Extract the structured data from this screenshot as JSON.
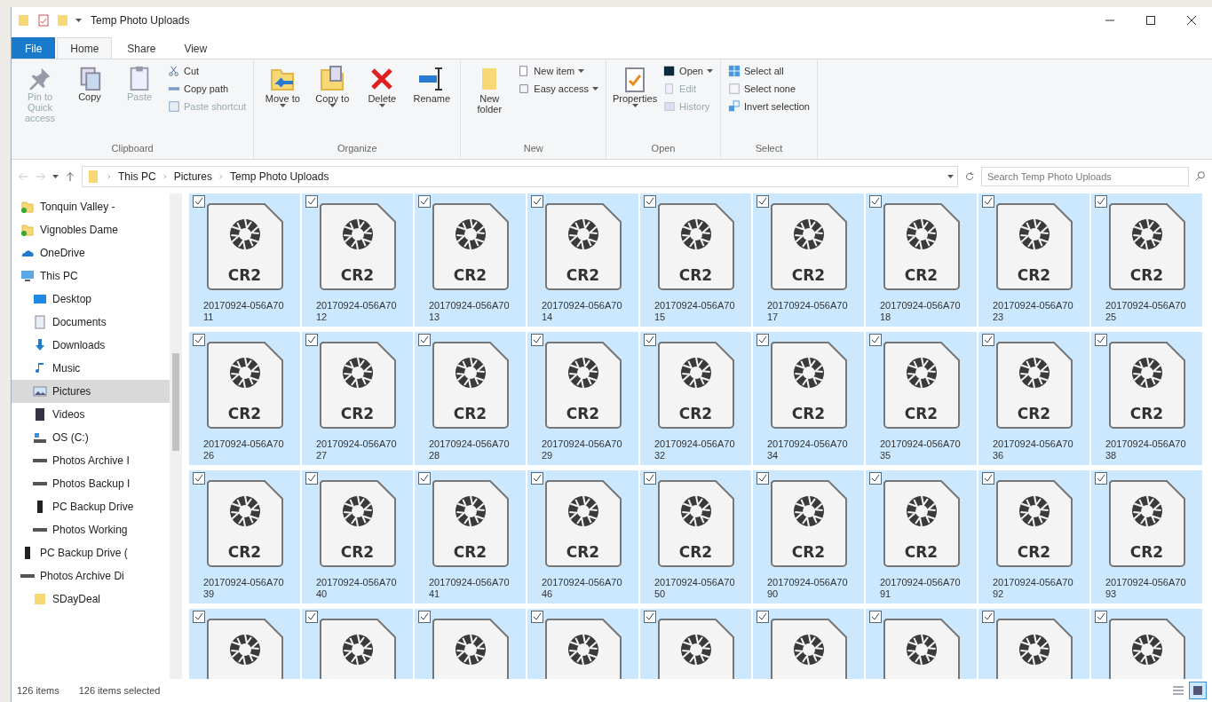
{
  "window": {
    "title": "Temp Photo Uploads"
  },
  "tabs": [
    {
      "label": "File",
      "kind": "file",
      "selected": false
    },
    {
      "label": "Home",
      "kind": "tab",
      "selected": true
    },
    {
      "label": "Share",
      "kind": "tab",
      "selected": false
    },
    {
      "label": "View",
      "kind": "tab",
      "selected": false
    }
  ],
  "ribbon": [
    {
      "label": "Clipboard",
      "buttons": [
        {
          "kind": "large",
          "label": "Pin to Quick access",
          "disabled": true,
          "dropdown": false
        },
        {
          "kind": "large",
          "label": "Copy",
          "disabled": false,
          "dropdown": false
        },
        {
          "kind": "large",
          "label": "Paste",
          "disabled": true,
          "dropdown": false
        },
        {
          "kind": "small",
          "label": "Cut",
          "disabled": false,
          "dropdown": false
        },
        {
          "kind": "small",
          "label": "Copy path",
          "disabled": false,
          "dropdown": false
        },
        {
          "kind": "small",
          "label": "Paste shortcut",
          "disabled": true,
          "dropdown": false
        }
      ]
    },
    {
      "label": "Organize",
      "buttons": [
        {
          "kind": "large",
          "label": "Move to",
          "disabled": false,
          "dropdown": true
        },
        {
          "kind": "large",
          "label": "Copy to",
          "disabled": false,
          "dropdown": true
        },
        {
          "kind": "large",
          "label": "Delete",
          "disabled": false,
          "dropdown": true
        },
        {
          "kind": "large",
          "label": "Rename",
          "disabled": false,
          "dropdown": false
        }
      ]
    },
    {
      "label": "New",
      "buttons": [
        {
          "kind": "large",
          "label": "New folder",
          "disabled": false,
          "dropdown": false
        },
        {
          "kind": "small",
          "label": "New item",
          "disabled": false,
          "dropdown": true
        },
        {
          "kind": "small",
          "label": "Easy access",
          "disabled": false,
          "dropdown": true
        }
      ]
    },
    {
      "label": "Open",
      "buttons": [
        {
          "kind": "large",
          "label": "Properties",
          "disabled": false,
          "dropdown": true
        },
        {
          "kind": "small",
          "label": "Open",
          "disabled": false,
          "dropdown": true
        },
        {
          "kind": "small",
          "label": "Edit",
          "disabled": true,
          "dropdown": false
        },
        {
          "kind": "small",
          "label": "History",
          "disabled": true,
          "dropdown": false
        }
      ]
    },
    {
      "label": "Select",
      "buttons": [
        {
          "kind": "small",
          "label": "Select all",
          "disabled": false,
          "dropdown": false
        },
        {
          "kind": "small",
          "label": "Select none",
          "disabled": false,
          "dropdown": false
        },
        {
          "kind": "small",
          "label": "Invert selection",
          "disabled": false,
          "dropdown": false
        }
      ]
    }
  ],
  "address": {
    "crumbs": [
      "This PC",
      "Pictures",
      "Temp Photo Uploads"
    ],
    "search": {
      "placeholder": "Search Temp Photo Uploads"
    }
  },
  "sidebar": {
    "items": [
      {
        "label": "Tonquin Valley -",
        "kind": "sync",
        "selected": false
      },
      {
        "label": "Vignobles Dame",
        "kind": "sync",
        "selected": false
      },
      {
        "label": "OneDrive",
        "kind": "cloud",
        "selected": false
      },
      {
        "label": "This PC",
        "kind": "pc",
        "selected": false,
        "children": [
          {
            "label": "Desktop",
            "kind": "desktop",
            "selected": false
          },
          {
            "label": "Documents",
            "kind": "docs",
            "selected": false
          },
          {
            "label": "Downloads",
            "kind": "down",
            "selected": false
          },
          {
            "label": "Music",
            "kind": "music",
            "selected": false
          },
          {
            "label": "Pictures",
            "kind": "pics",
            "selected": true
          },
          {
            "label": "Videos",
            "kind": "video",
            "selected": false
          },
          {
            "label": "OS (C:)",
            "kind": "os",
            "selected": false
          },
          {
            "label": "Photos Archive I",
            "kind": "drive",
            "selected": false
          },
          {
            "label": "Photos Backup I",
            "kind": "drive",
            "selected": false
          },
          {
            "label": "PC Backup Drive",
            "kind": "usb",
            "selected": false
          },
          {
            "label": "Photos Working",
            "kind": "drive",
            "selected": false
          }
        ]
      },
      {
        "label": "PC Backup Drive (",
        "kind": "usb",
        "selected": false
      },
      {
        "label": "Photos Archive Di",
        "kind": "drive",
        "selected": false,
        "children": [
          {
            "label": "SDayDeal",
            "kind": "folder",
            "selected": false
          }
        ]
      }
    ]
  },
  "files": [
    {
      "name": "20170924-056A7011",
      "ext": "CR2",
      "checked": true,
      "selected": true
    },
    {
      "name": "20170924-056A7012",
      "ext": "CR2",
      "checked": true,
      "selected": true
    },
    {
      "name": "20170924-056A7013",
      "ext": "CR2",
      "checked": true,
      "selected": true
    },
    {
      "name": "20170924-056A7014",
      "ext": "CR2",
      "checked": true,
      "selected": true
    },
    {
      "name": "20170924-056A7015",
      "ext": "CR2",
      "checked": true,
      "selected": true
    },
    {
      "name": "20170924-056A7017",
      "ext": "CR2",
      "checked": true,
      "selected": true
    },
    {
      "name": "20170924-056A7018",
      "ext": "CR2",
      "checked": true,
      "selected": true
    },
    {
      "name": "20170924-056A7023",
      "ext": "CR2",
      "checked": true,
      "selected": true
    },
    {
      "name": "20170924-056A7025",
      "ext": "CR2",
      "checked": true,
      "selected": true
    },
    {
      "name": "20170924-056A7026",
      "ext": "CR2",
      "checked": true,
      "selected": true
    },
    {
      "name": "20170924-056A7027",
      "ext": "CR2",
      "checked": true,
      "selected": true
    },
    {
      "name": "20170924-056A7028",
      "ext": "CR2",
      "checked": true,
      "selected": true
    },
    {
      "name": "20170924-056A7029",
      "ext": "CR2",
      "checked": true,
      "selected": true
    },
    {
      "name": "20170924-056A7032",
      "ext": "CR2",
      "checked": true,
      "selected": true
    },
    {
      "name": "20170924-056A7034",
      "ext": "CR2",
      "checked": true,
      "selected": true
    },
    {
      "name": "20170924-056A7035",
      "ext": "CR2",
      "checked": true,
      "selected": true
    },
    {
      "name": "20170924-056A7036",
      "ext": "CR2",
      "checked": true,
      "selected": true
    },
    {
      "name": "20170924-056A7038",
      "ext": "CR2",
      "checked": true,
      "selected": true
    },
    {
      "name": "20170924-056A7039",
      "ext": "CR2",
      "checked": true,
      "selected": true
    },
    {
      "name": "20170924-056A7040",
      "ext": "CR2",
      "checked": true,
      "selected": true
    },
    {
      "name": "20170924-056A7041",
      "ext": "CR2",
      "checked": true,
      "selected": true
    },
    {
      "name": "20170924-056A7046",
      "ext": "CR2",
      "checked": true,
      "selected": true
    },
    {
      "name": "20170924-056A7050",
      "ext": "CR2",
      "checked": true,
      "selected": true
    },
    {
      "name": "20170924-056A7090",
      "ext": "CR2",
      "checked": true,
      "selected": true
    },
    {
      "name": "20170924-056A7091",
      "ext": "CR2",
      "checked": true,
      "selected": true
    },
    {
      "name": "20170924-056A7092",
      "ext": "CR2",
      "checked": true,
      "selected": true
    },
    {
      "name": "20170924-056A7093",
      "ext": "CR2",
      "checked": true,
      "selected": true
    },
    {
      "checked": true,
      "selected": true
    },
    {
      "checked": true,
      "selected": true
    },
    {
      "checked": true,
      "selected": true
    },
    {
      "checked": true,
      "selected": true
    },
    {
      "checked": true,
      "selected": true
    },
    {
      "checked": true,
      "selected": true
    },
    {
      "checked": true,
      "selected": true
    },
    {
      "checked": true,
      "selected": true
    },
    {
      "checked": true,
      "selected": true
    }
  ],
  "status_bar": {
    "count": "126 items",
    "selection": "126 items selected",
    "views": [
      {
        "kind": "details",
        "selected": false
      },
      {
        "kind": "icons",
        "selected": true
      }
    ]
  }
}
